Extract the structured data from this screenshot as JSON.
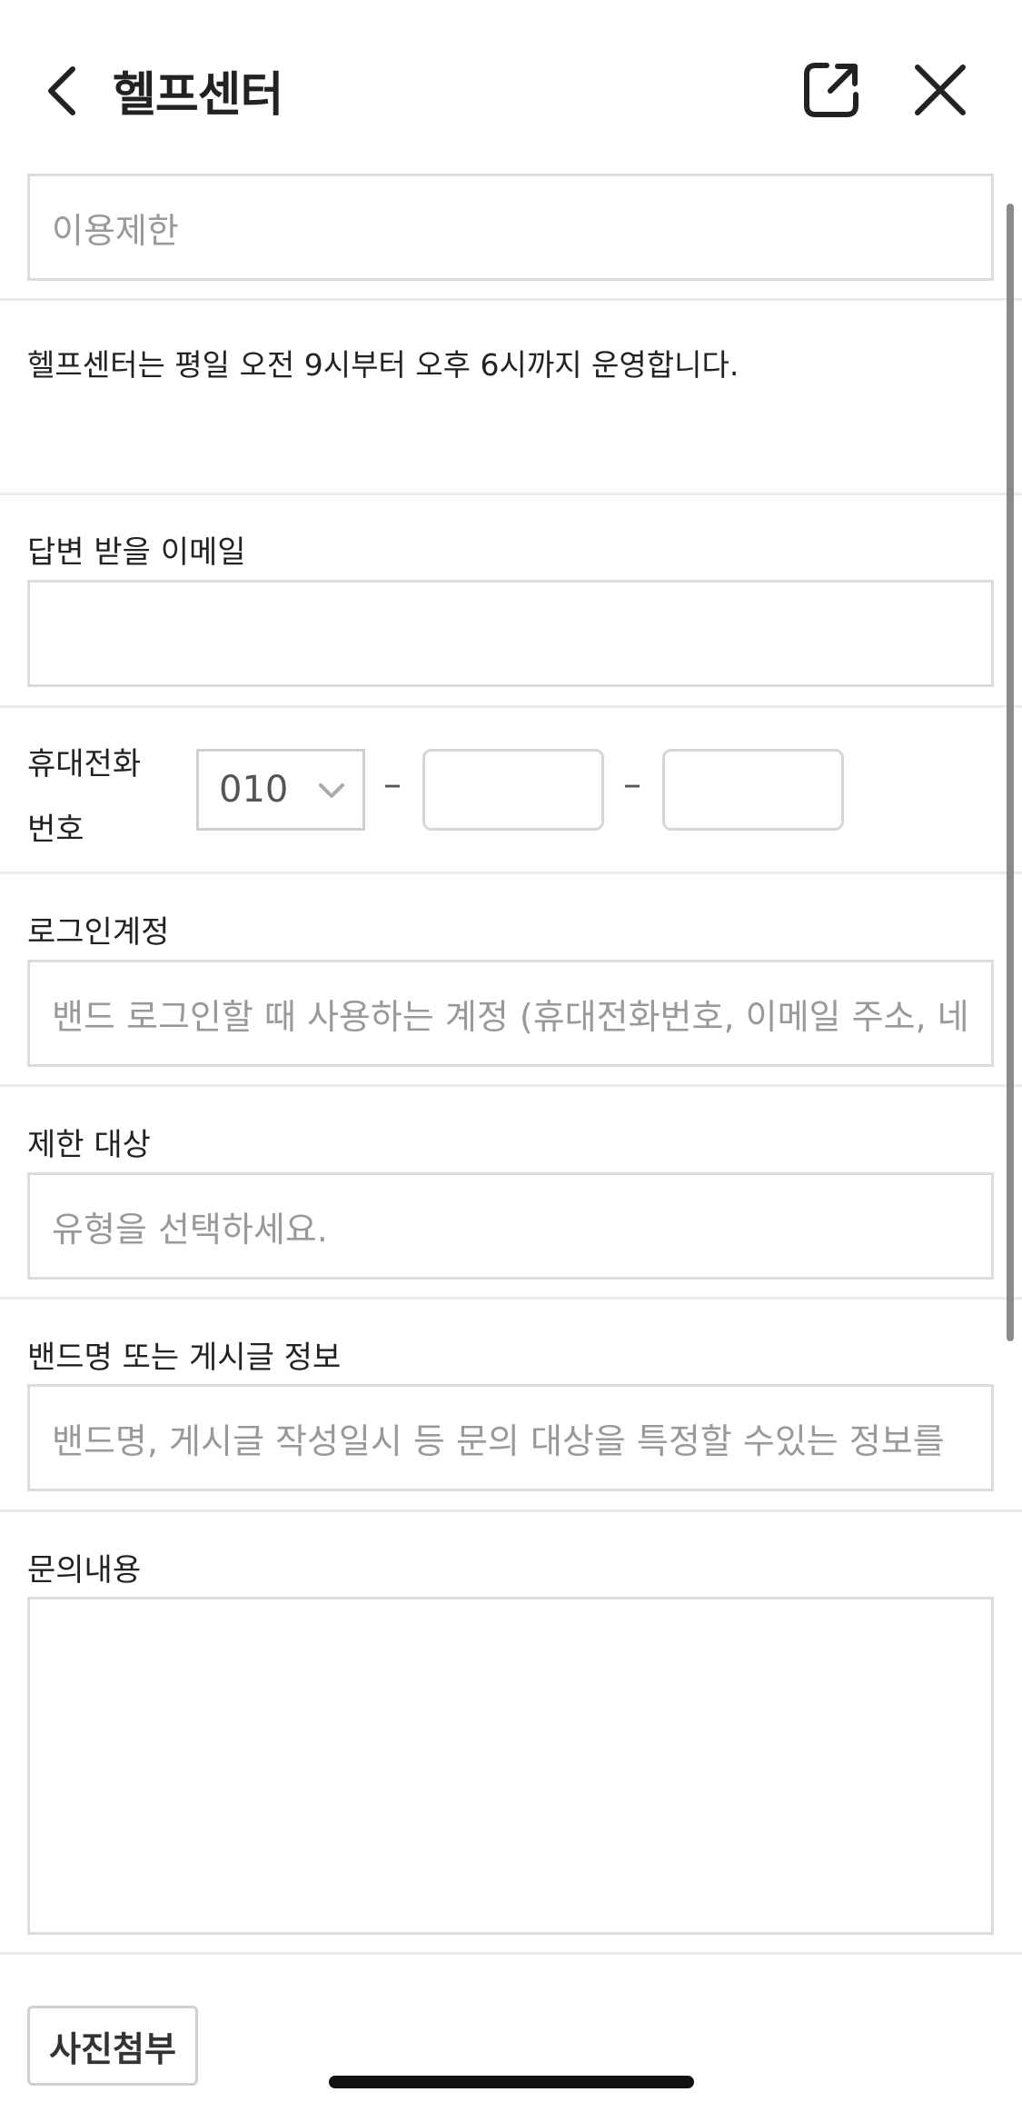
{
  "header": {
    "title": "헬프센터",
    "back_icon": "chevron-left-icon",
    "share_icon": "external-link-icon",
    "close_icon": "close-icon"
  },
  "form": {
    "category_value": "이용제한",
    "notice": "헬프센터는 평일 오전 9시부터 오후 6시까지 운영합니다.",
    "email_label": "답변 받을 이메일",
    "email_value": "",
    "phone_label_line1": "휴대전화",
    "phone_label_line2": "번호",
    "phone_prefix": "010",
    "phone_dash": "–",
    "login_label": "로그인계정",
    "login_placeholder": "밴드 로그인할 때 사용하는 계정 (휴대전화번호, 이메일 주소, 네",
    "target_label": "제한 대상",
    "target_placeholder": "유형을 선택하세요.",
    "band_info_label": "밴드명 또는 게시글 정보",
    "band_info_placeholder": "밴드명, 게시글 작성일시 등 문의 대상을 특정할 수있는 정보를",
    "inquiry_label": "문의내용",
    "attach_button": "사진첨부"
  }
}
